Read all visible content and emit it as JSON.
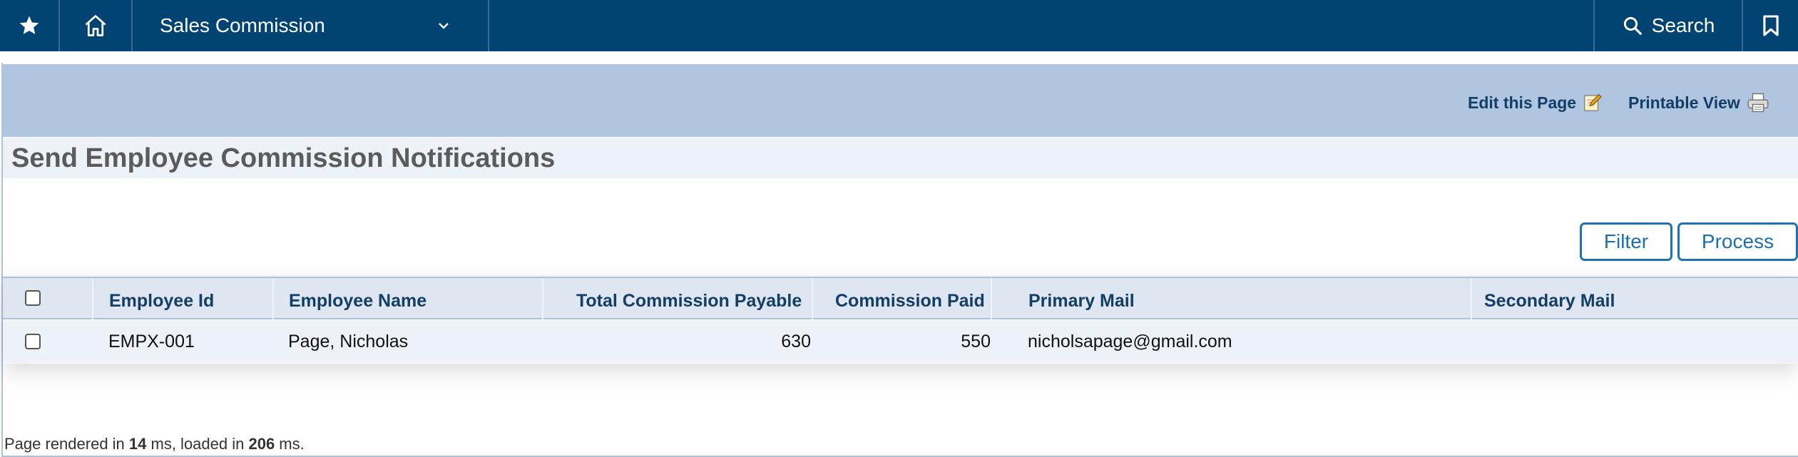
{
  "nav": {
    "module_label": "Sales Commission",
    "search_label": "Search"
  },
  "toolbar": {
    "edit_label": "Edit this Page",
    "print_label": "Printable View"
  },
  "page": {
    "title": "Send Employee Commission Notifications"
  },
  "buttons": {
    "filter": "Filter",
    "process": "Process"
  },
  "table": {
    "columns": [
      "Employee Id",
      "Employee Name",
      "Total Commission Payable",
      "Commission Paid",
      "Primary Mail",
      "Secondary Mail"
    ],
    "rows": [
      {
        "employee_id": "EMPX-001",
        "employee_name": "Page, Nicholas",
        "total_commission_payable": "630",
        "commission_paid": "550",
        "primary_mail": "nicholsapage@gmail.com",
        "secondary_mail": ""
      }
    ]
  },
  "footer": {
    "prefix": "Page rendered in ",
    "render_ms": "14",
    "middle": " ms, loaded in ",
    "load_ms": "206",
    "suffix": " ms."
  },
  "colors": {
    "nav_bg": "#014372",
    "toolbar_bg": "#b0c5e0",
    "accent": "#1c72b5",
    "header_text": "#143e66"
  },
  "icons": [
    "star-icon",
    "home-icon",
    "chevron-down-icon",
    "search-icon",
    "bookmark-icon",
    "edit-icon",
    "printer-icon"
  ]
}
